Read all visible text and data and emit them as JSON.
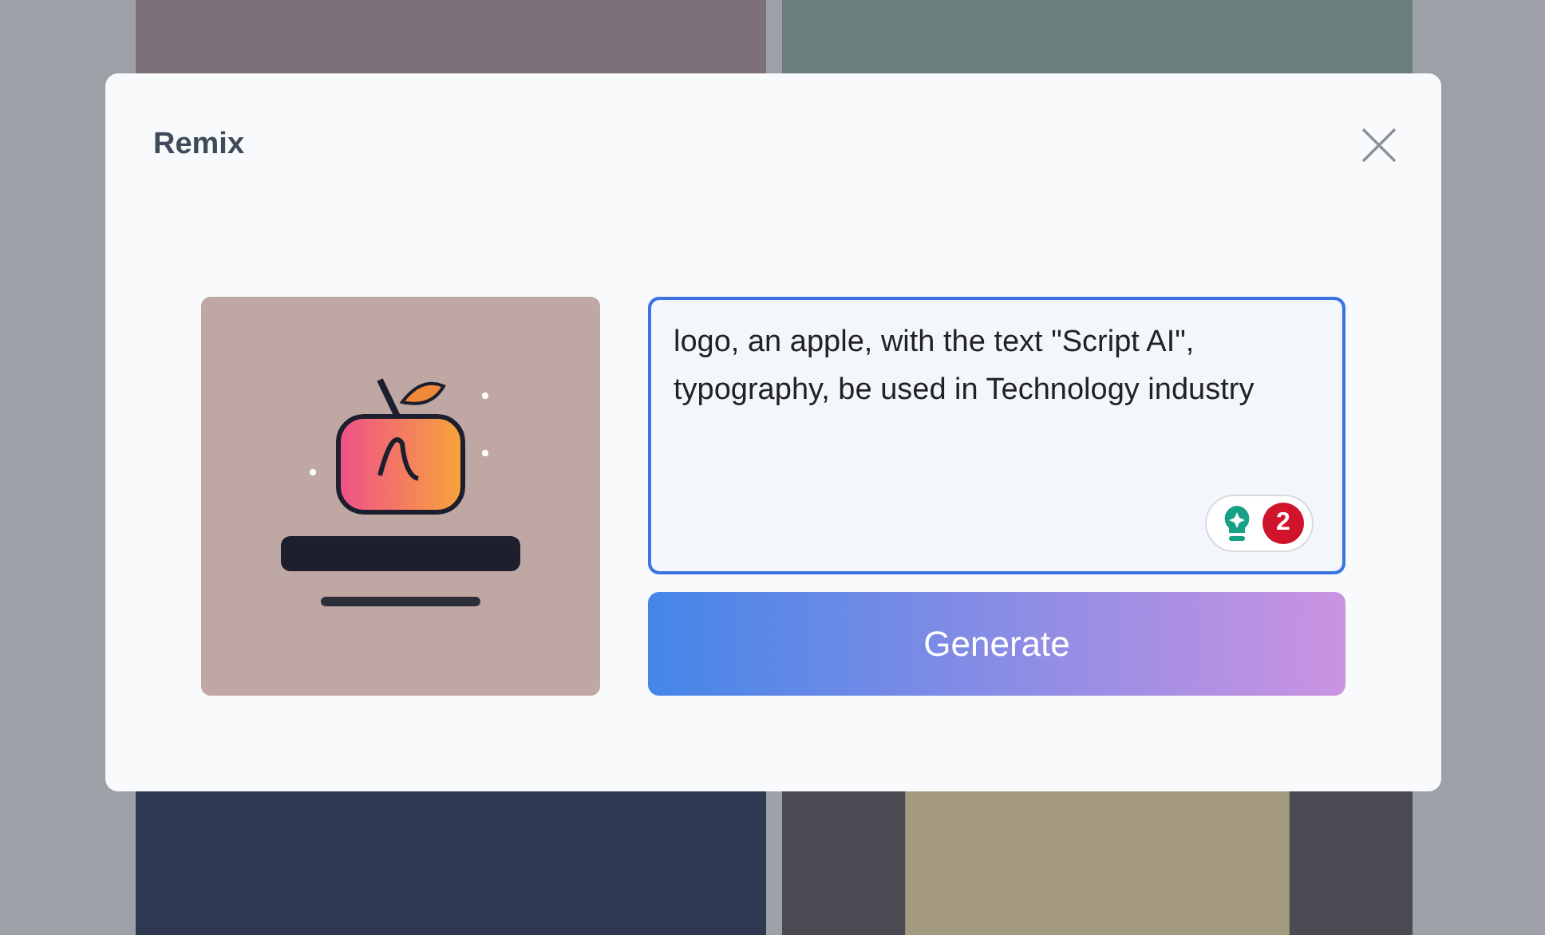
{
  "dialog": {
    "title": "Remix",
    "prompt": {
      "value": "logo, an apple, with the text \"Script AI\", typography, be used in Technology industry"
    },
    "assistant_badge": {
      "count": "2"
    },
    "generate_button": "Generate"
  }
}
